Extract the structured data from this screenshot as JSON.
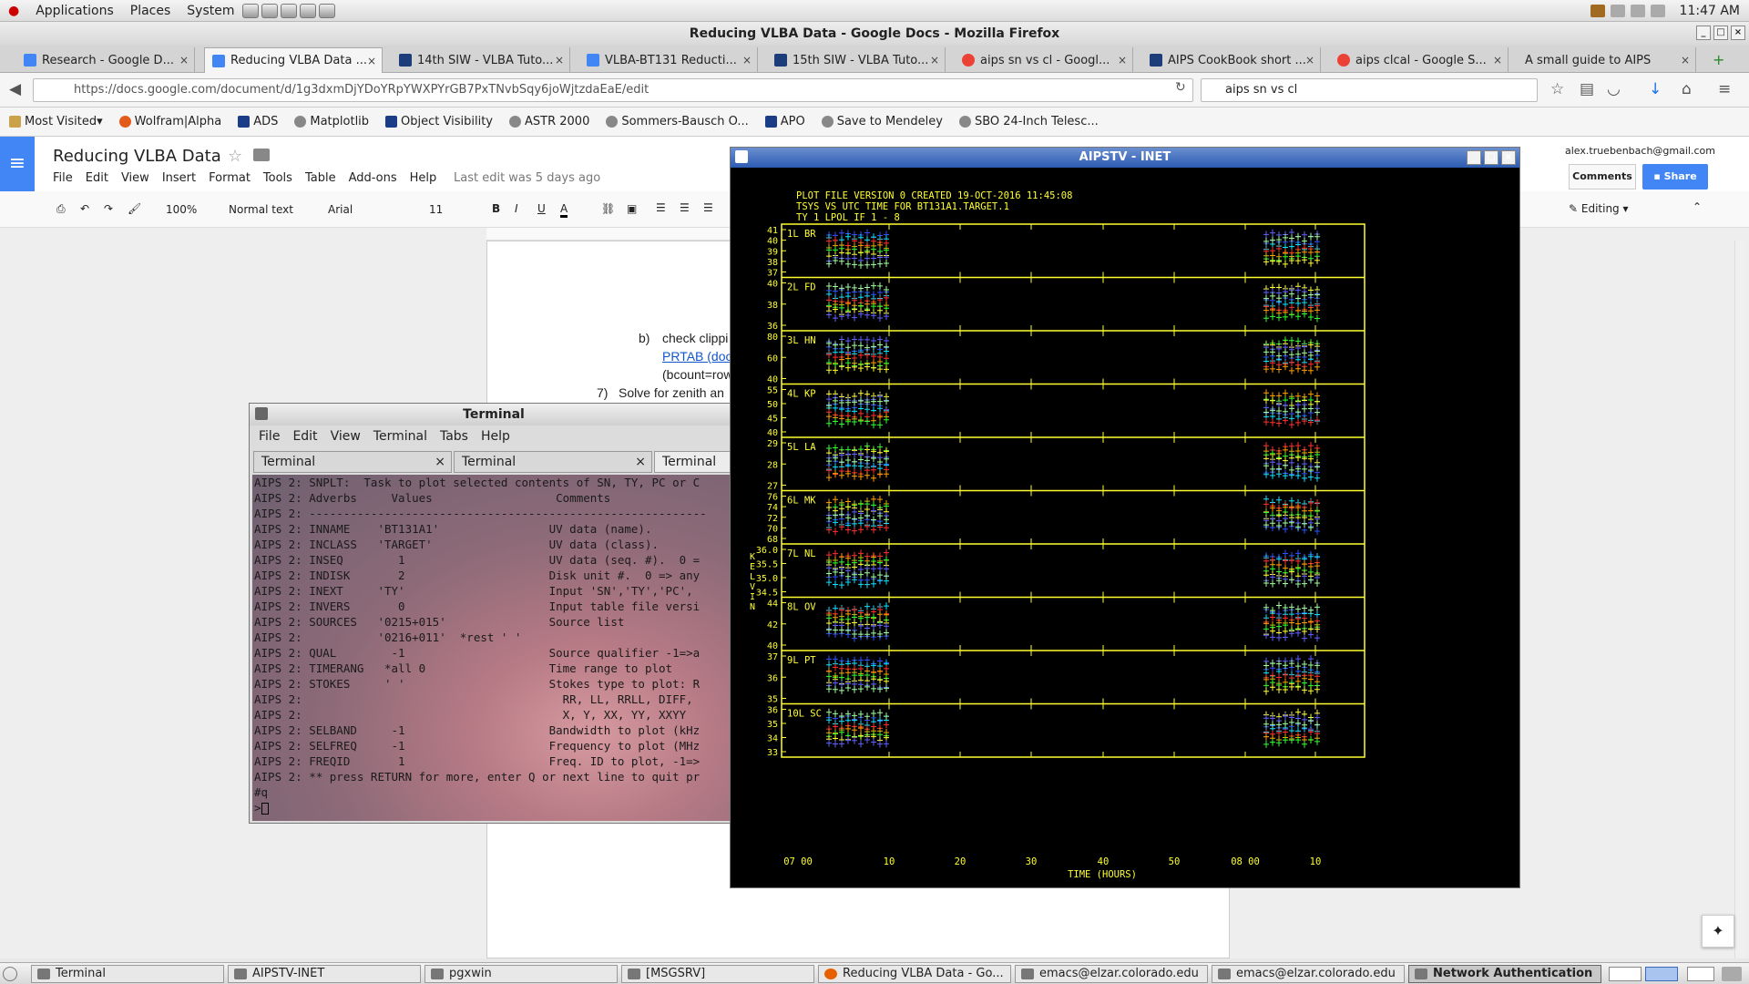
{
  "gnome_panel": {
    "menus": [
      "Applications",
      "Places",
      "System"
    ],
    "clock": "11:47 AM"
  },
  "firefox": {
    "window_title": "Reducing VLBA Data - Google Docs - Mozilla Firefox",
    "tabs": [
      {
        "label": "Research - Google D...",
        "active": false
      },
      {
        "label": "Reducing VLBA Data ...",
        "active": true
      },
      {
        "label": "14th SIW - VLBA Tuto...",
        "active": false
      },
      {
        "label": "VLBA-BT131 Reducti...",
        "active": false
      },
      {
        "label": "15th SIW - VLBA Tuto...",
        "active": false
      },
      {
        "label": "aips sn vs cl - Googl...",
        "active": false
      },
      {
        "label": "AIPS CookBook short ...",
        "active": false
      },
      {
        "label": "aips clcal - Google S...",
        "active": false
      },
      {
        "label": "A small guide to AIPS",
        "active": false
      }
    ],
    "url": "https://docs.google.com/document/d/1g3dxmDjYDoYRpYWXPYrGB7PxTNvbSqy6joWjtzdaEaE/edit",
    "search_value": "aips sn vs cl",
    "bookmarks": [
      "Most Visited",
      "Wolfram|Alpha",
      "ADS",
      "Matplotlib",
      "Object Visibility",
      "ASTR 2000",
      "Sommers-Bausch O...",
      "APO",
      "Save to Mendeley",
      "SBO 24-Inch Telesc..."
    ]
  },
  "docs": {
    "title": "Reducing VLBA Data",
    "menu": [
      "File",
      "Edit",
      "View",
      "Insert",
      "Format",
      "Tools",
      "Table",
      "Add-ons",
      "Help"
    ],
    "last_edit": "Last edit was 5 days ago",
    "zoom": "100%",
    "style": "Normal text",
    "font": "Arial",
    "font_size": "11",
    "email": "alex.truebenbach@gmail.com",
    "comments_label": "Comments",
    "share_label": "Share",
    "mode_label": "Editing",
    "body_lines": [
      {
        "marker": "b)",
        "text": "check clippi"
      },
      {
        "marker": "",
        "text": "PRTAB (doc"
      },
      {
        "marker": "",
        "text": "(bcount=row"
      },
      {
        "marker": "7)",
        "text": "Solve for zenith an"
      }
    ]
  },
  "terminal": {
    "title": "Terminal",
    "menu": [
      "File",
      "Edit",
      "View",
      "Terminal",
      "Tabs",
      "Help"
    ],
    "tabs": [
      "Terminal",
      "Terminal",
      "Terminal"
    ],
    "lines": [
      "AIPS 2: SNPLT:  Task to plot selected contents of SN, TY, PC or C",
      "AIPS 2: Adverbs     Values                  Comments",
      "AIPS 2: ----------------------------------------------------------",
      "AIPS 2: INNAME    'BT131A1'                UV data (name).",
      "AIPS 2: INCLASS   'TARGET'                 UV data (class).",
      "AIPS 2: INSEQ        1                     UV data (seq. #).  0 =",
      "AIPS 2: INDISK       2                     Disk unit #.  0 => any",
      "AIPS 2: INEXT     'TY'                     Input 'SN','TY','PC',",
      "AIPS 2: INVERS       0                     Input table file versi",
      "AIPS 2: SOURCES   '0215+015'               Source list",
      "AIPS 2:           '0216+011'  *rest ' '",
      "AIPS 2: QUAL        -1                     Source qualifier -1=>a",
      "AIPS 2: TIMERANG   *all 0                  Time range to plot",
      "AIPS 2: STOKES     ' '                     Stokes type to plot: R",
      "AIPS 2:                                      RR, LL, RRLL, DIFF,",
      "AIPS 2:                                      X, Y, XX, YY, XXYY",
      "AIPS 2: SELBAND     -1                     Bandwidth to plot (kHz",
      "AIPS 2: SELFREQ     -1                     Frequency to plot (MHz",
      "AIPS 2: FREQID       1                     Freq. ID to plot, -1=>",
      "AIPS 2: ** press RETURN for more, enter Q or next line to quit pr",
      "#q",
      ">"
    ]
  },
  "aipstv": {
    "title": "AIPSTV - INET",
    "header": [
      "PLOT FILE VERSION 0  CREATED 19-OCT-2016 11:45:08",
      "TSYS VS UTC TIME FOR BT131A1.TARGET.1",
      "TY 1  LPOL  IF 1 - 8"
    ],
    "ylabel": "KELVIN",
    "xlabel": "TIME (HOURS)",
    "x_ticks": [
      "07 00",
      "10",
      "20",
      "30",
      "40",
      "50",
      "08 00",
      "10"
    ],
    "panels": [
      {
        "label": "1L BR",
        "ticks": [
          "41",
          "40",
          "39",
          "38",
          "37"
        ]
      },
      {
        "label": "2L FD",
        "ticks": [
          "40",
          "38",
          "36"
        ]
      },
      {
        "label": "3L HN",
        "ticks": [
          "80",
          "60",
          "40"
        ]
      },
      {
        "label": "4L KP",
        "ticks": [
          "55",
          "50",
          "45",
          "40"
        ]
      },
      {
        "label": "5L LA",
        "ticks": [
          "29",
          "28",
          "27"
        ]
      },
      {
        "label": "6L MK",
        "ticks": [
          "76",
          "74",
          "72",
          "70",
          "68"
        ]
      },
      {
        "label": "7L NL",
        "ticks": [
          "36.0",
          "35.5",
          "35.0",
          "34.5"
        ]
      },
      {
        "label": "8L OV",
        "ticks": [
          "44",
          "42",
          "40"
        ]
      },
      {
        "label": "9L PT",
        "ticks": [
          "37",
          "36",
          "35"
        ]
      },
      {
        "label": "10L SC",
        "ticks": [
          "36",
          "35",
          "34",
          "33"
        ]
      }
    ],
    "series_colors": [
      "#3050ff",
      "#10e0ff",
      "#ff3030",
      "#ffa000",
      "#30ff30",
      "#ffff30",
      "#6060ff",
      "#a0ffa0"
    ]
  },
  "taskbar": {
    "items": [
      {
        "label": "Terminal",
        "active": false
      },
      {
        "label": "AIPSTV-INET",
        "active": false
      },
      {
        "label": "pgxwin",
        "active": false
      },
      {
        "label": "[MSGSRV]",
        "active": false
      },
      {
        "label": "Reducing VLBA Data - Go...",
        "active": false
      },
      {
        "label": "emacs@elzar.colorado.edu",
        "active": false
      },
      {
        "label": "emacs@elzar.colorado.edu",
        "active": false
      },
      {
        "label": "Network Authentication",
        "active": true
      }
    ]
  }
}
